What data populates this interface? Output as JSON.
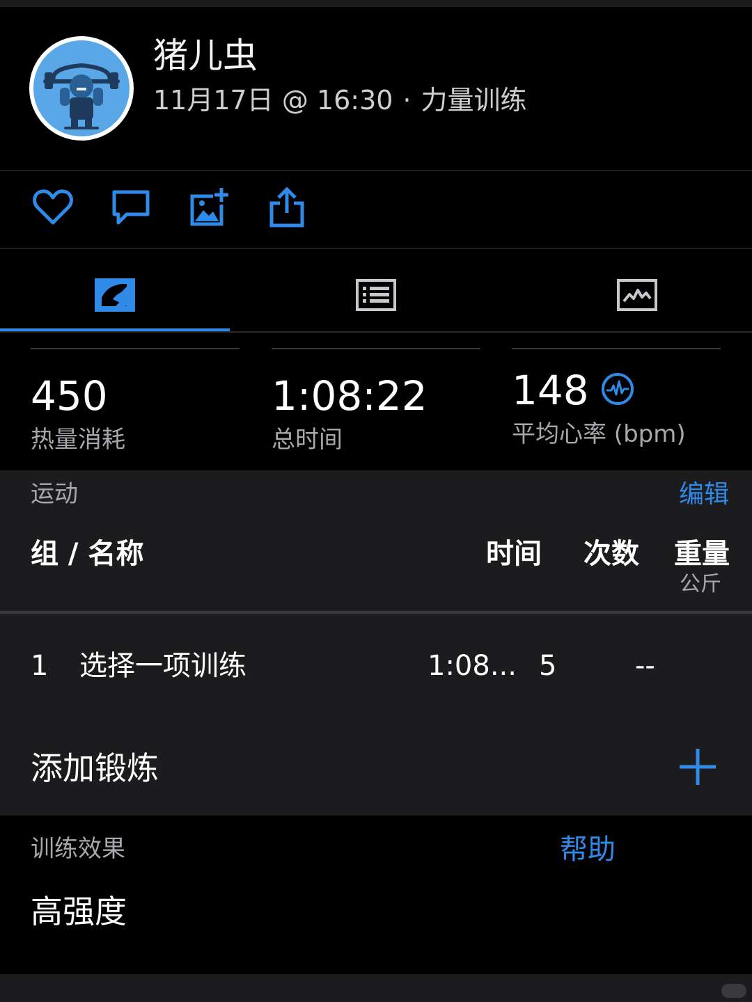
{
  "header": {
    "username": "猪儿虫",
    "date": "11月17日",
    "at": "@",
    "time": "16:30",
    "dot": "·",
    "activity_type": "力量训练"
  },
  "actions": [
    {
      "icon": "heart-icon"
    },
    {
      "icon": "comment-icon"
    },
    {
      "icon": "add-photo-icon"
    },
    {
      "icon": "share-icon"
    }
  ],
  "tabs": [
    {
      "icon": "summary-chart-icon",
      "active": true
    },
    {
      "icon": "list-icon",
      "active": false
    },
    {
      "icon": "graph-icon",
      "active": false
    }
  ],
  "stats": {
    "calories": {
      "value": "450",
      "label": "热量消耗"
    },
    "total_time": {
      "value": "1:08:22",
      "label": "总时间"
    },
    "avg_hr": {
      "value": "148",
      "label": "平均心率 (bpm)",
      "icon": "heart-rate-icon"
    }
  },
  "exercise_section": {
    "title": "运动",
    "edit": "编辑",
    "columns": {
      "set_name": "组 / 名称",
      "time": "时间",
      "reps": "次数",
      "weight": "重量",
      "weight_unit": "公斤"
    },
    "rows": [
      {
        "index": "1",
        "name": "选择一项训练",
        "time": "1:08...",
        "reps": "5",
        "weight": "--"
      }
    ],
    "add_label": "添加锻炼"
  },
  "training_effect": {
    "title": "训练效果",
    "help": "帮助",
    "value": "高强度"
  },
  "colors": {
    "accent": "#2f8ae8",
    "background": "#000000",
    "panel": "#1c1c1e"
  }
}
